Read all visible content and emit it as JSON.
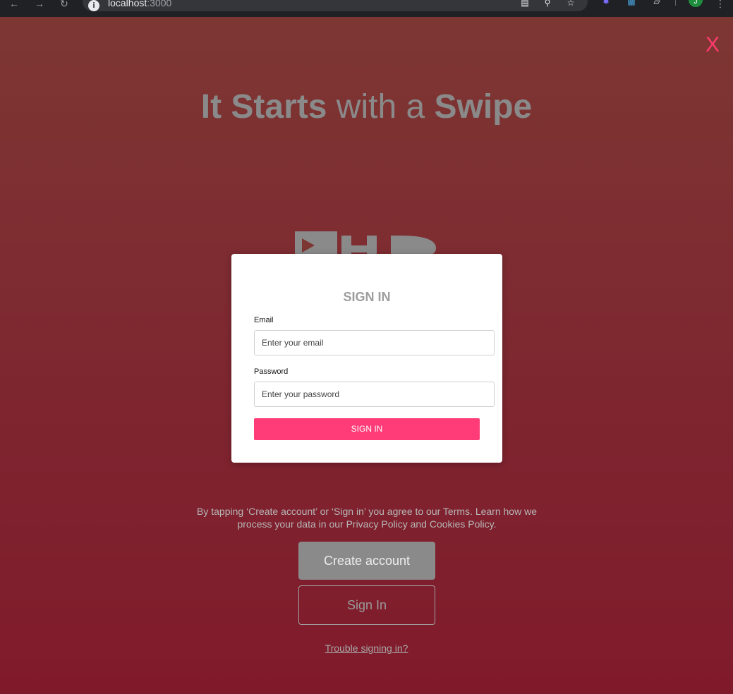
{
  "browser": {
    "url_host": "localhost",
    "url_port": ":3000",
    "profile_initial": "J"
  },
  "page": {
    "close_label": "X",
    "headline": {
      "part1": "It Starts",
      "part2": " with a ",
      "part3": "Swipe"
    },
    "colors": {
      "accent": "#ff3b78",
      "background_top": "#7d3733",
      "background_bottom": "#801a2b"
    }
  },
  "modal": {
    "title": "SIGN IN",
    "email_label": "Email",
    "email_placeholder": "Enter your email",
    "password_label": "Password",
    "password_placeholder": "Enter your password",
    "submit_label": "SIGN IN"
  },
  "terms_text": "By tapping ‘Create account’ or ‘Sign in’ you agree to our Terms. Learn how we process your data in our Privacy Policy and Cookies Policy.",
  "actions": {
    "create_account": "Create account",
    "sign_in": "Sign In",
    "trouble": "Trouble signing in?"
  }
}
